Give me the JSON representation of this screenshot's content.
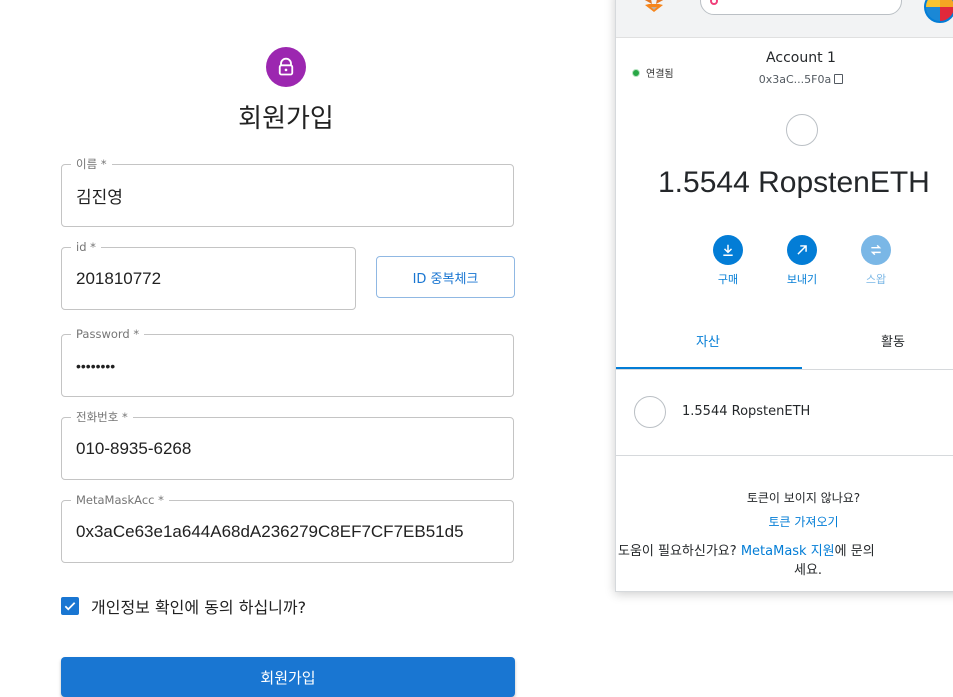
{
  "form": {
    "title": "회원가입",
    "fields": [
      {
        "label": "이름 *",
        "value": "김진영"
      },
      {
        "label": "id *",
        "value": "201810772"
      },
      {
        "label": "Password *",
        "value": "••••••••"
      },
      {
        "label": "전화번호 *",
        "value": "010-8935-6268"
      },
      {
        "label": "MetaMaskAcc *",
        "value": "0x3aCe63e1a644A68dA236279C8EF7CF7EB51d5"
      }
    ],
    "dup_check_label": "ID 중복체크",
    "agree_label": "개인정보 확인에 동의 하십니까?",
    "agree_checked": true,
    "submit_label": "회원가입",
    "colors": {
      "primary": "#1976d2",
      "avatar": "#9c27b0"
    }
  },
  "metamask": {
    "connection_status": "연결됨",
    "account_name": "Account 1",
    "account_address": "0x3aC...5F0a",
    "balance": "1.5544 RopstenETH",
    "actions": [
      {
        "label": "구매",
        "icon": "download-icon"
      },
      {
        "label": "보내기",
        "icon": "send-arrow-icon"
      },
      {
        "label": "스왑",
        "icon": "swap-icon",
        "disabled": true
      }
    ],
    "tabs": [
      {
        "label": "자산",
        "active": true
      },
      {
        "label": "활동",
        "active": false
      }
    ],
    "asset_row": "1.5544 RopstenETH",
    "no_tokens_text": "토큰이 보이지 않나요?",
    "import_tokens_link": "토큰 가져오기",
    "help_prefix": "도움이 필요하신가요?",
    "help_link": "MetaMask 지원",
    "help_suffix": "에 문의",
    "help_suffix2": "세요.",
    "colors": {
      "accent": "#037dd6"
    }
  }
}
